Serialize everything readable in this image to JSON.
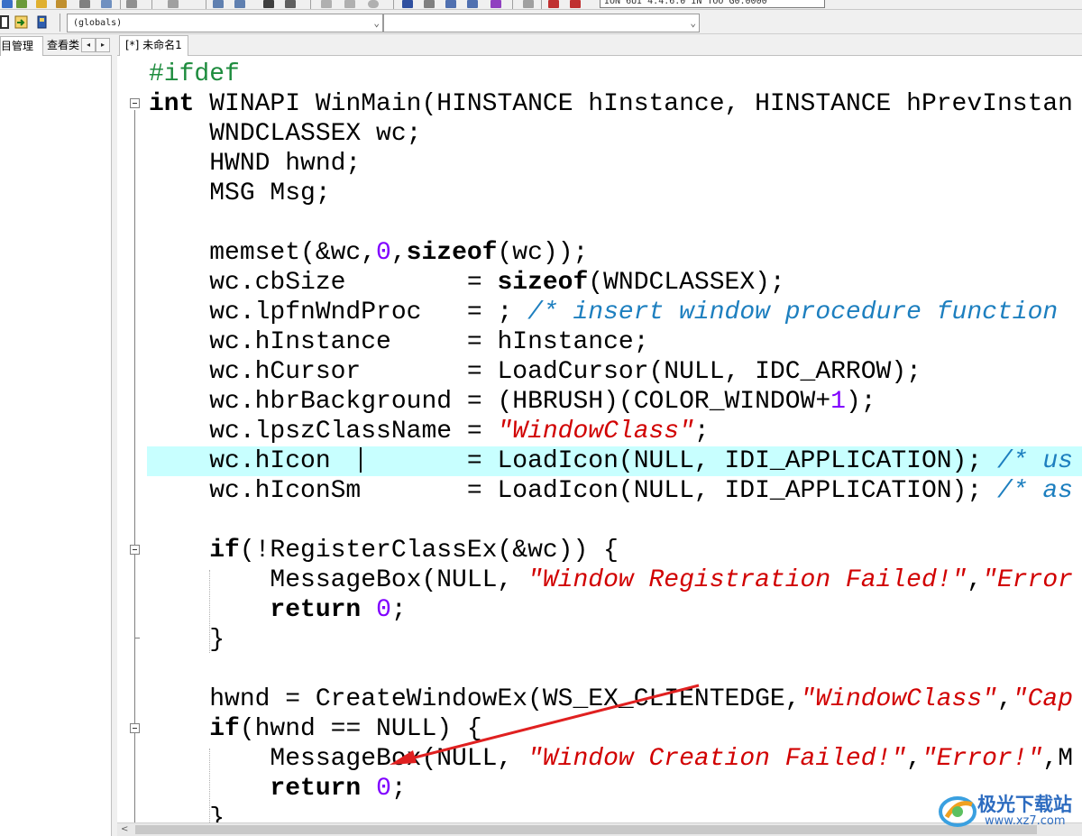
{
  "toolbar": {
    "top_combo_text": "ION 6UI 4.4.6.0 IN TOO G0.0000",
    "scope_combo_value": "(globals)",
    "member_combo_value": ""
  },
  "left_panel": {
    "tabs": [
      "目管理",
      "查看类"
    ],
    "scroll_left": "◂",
    "scroll_right": "▸"
  },
  "editor": {
    "tab_label": "[*] 未命名1"
  },
  "code": {
    "l1": "#ifdef",
    "l2_kw": "int",
    "l2_rest": " WINAPI WinMain(HINSTANCE hInstance, HINSTANCE hPrevInstan",
    "l3": "    WNDCLASSEX wc;",
    "l4": "    HWND hwnd;",
    "l5": "    MSG Msg;",
    "l7_a": "    memset(&wc,",
    "l7_num": "0",
    "l7_b": ",",
    "l7_kw": "sizeof",
    "l7_c": "(wc));",
    "l8_a": "    wc.cbSize        = ",
    "l8_kw": "sizeof",
    "l8_b": "(WNDCLASSEX);",
    "l9_a": "    wc.lpfnWndProc   = ; ",
    "l9_cmt": "/* insert window procedure function",
    "l10": "    wc.hInstance     = hInstance;",
    "l11": "    wc.hCursor       = LoadCursor(NULL, IDC_ARROW);",
    "l12_a": "    wc.hbrBackground = (HBRUSH)(COLOR_WINDOW+",
    "l12_num": "1",
    "l12_b": ");",
    "l13_a": "    wc.lpszClassName = ",
    "l13_str": "\"WindowClass\"",
    "l13_b": ";",
    "l14_a": "    wc.hIcon         = LoadIcon(NULL, IDI_APPLICATION); ",
    "l14_cmt": "/* us",
    "l15_a": "    wc.hIconSm       = LoadIcon(NULL, IDI_APPLICATION); ",
    "l15_cmt": "/* as",
    "l17_a": "    ",
    "l17_kw": "if",
    "l17_b": "(!RegisterClassEx(&wc)) {",
    "l18_a": "        MessageBox(NULL, ",
    "l18_str1": "\"Window Registration Failed!\"",
    "l18_b": ",",
    "l18_str2": "\"Error",
    "l19_a": "        ",
    "l19_kw": "return",
    "l19_b": " ",
    "l19_num": "0",
    "l19_c": ";",
    "l20": "    }",
    "l22_a": "    hwnd = CreateWindowEx(WS_EX_CLIENTEDGE,",
    "l22_str1": "\"WindowClass\"",
    "l22_b": ",",
    "l22_str2": "\"Cap",
    "l23_a": "    ",
    "l23_kw": "if",
    "l23_b": "(hwnd == NULL) {",
    "l24_a": "        MessageBox(NULL, ",
    "l24_str1": "\"Window Creation Failed!\"",
    "l24_b": ",",
    "l24_str2": "\"Error!\"",
    "l24_c": ",M",
    "l25_a": "        ",
    "l25_kw": "return",
    "l25_b": " ",
    "l25_num": "0",
    "l25_c": ";",
    "l26": "    }"
  },
  "watermark": {
    "title": "极光下载站",
    "url": "www.xz7.com"
  },
  "colors": {
    "highlight_line": "#c8ffff",
    "comment": "#1d7fbf",
    "string": "#d10000",
    "number": "#8000ff",
    "preprocessor": "#1e8c3e",
    "annotation_arrow": "#e02020"
  }
}
